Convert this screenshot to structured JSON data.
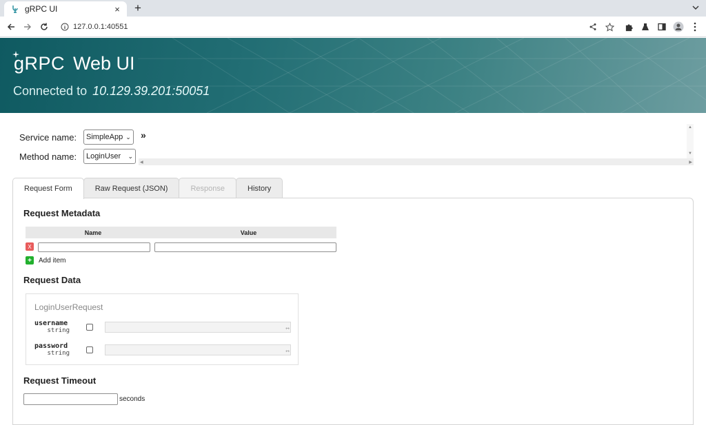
{
  "browser": {
    "tab_title": "gRPC UI",
    "tab_close": "×",
    "new_tab": "+",
    "url": "127.0.0.1:40551"
  },
  "header": {
    "brand_grpc": "gRPC",
    "brand_webui": "Web UI",
    "connected_label": "Connected to",
    "connected_address": "10.129.39.201:50051"
  },
  "selection": {
    "service_label": "Service name:",
    "service_value": "SimpleApp",
    "method_label": "Method name:",
    "method_value": "LoginUser",
    "expand_glyph": "»"
  },
  "tabs": [
    {
      "label": "Request Form",
      "state": "active"
    },
    {
      "label": "Raw Request (JSON)",
      "state": "normal"
    },
    {
      "label": "Response",
      "state": "disabled"
    },
    {
      "label": "History",
      "state": "normal"
    }
  ],
  "metadata": {
    "title": "Request Metadata",
    "col_name": "Name",
    "col_value": "Value",
    "remove_glyph": "X",
    "add_glyph": "+",
    "add_label": "Add item"
  },
  "request_data": {
    "title": "Request Data",
    "message_name": "LoginUserRequest",
    "fields": [
      {
        "name": "username",
        "type": "string"
      },
      {
        "name": "password",
        "type": "string"
      }
    ]
  },
  "timeout": {
    "title": "Request Timeout",
    "unit": "seconds"
  },
  "colors": {
    "banner": "#226e74",
    "remove": "#e85c5c",
    "add": "#22b02e"
  }
}
